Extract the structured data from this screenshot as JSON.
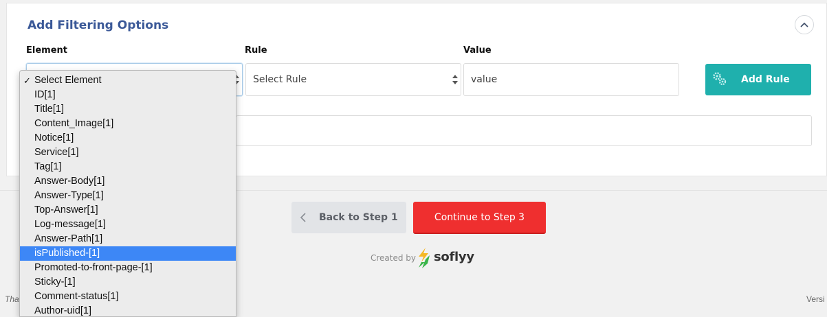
{
  "panel": {
    "title": "Add Filtering Options"
  },
  "fields": {
    "element_label": "Element",
    "rule_label": "Rule",
    "value_label": "Value",
    "rule_select_value": "Select Rule",
    "value_placeholder": "value",
    "add_rule_label": "Add Rule"
  },
  "dropdown": {
    "checked_item": "Select Element",
    "items": [
      "Select Element",
      "ID[1]",
      "Title[1]",
      "Content_Image[1]",
      "Notice[1]",
      "Service[1]",
      "Tag[1]",
      "Answer-Body[1]",
      "Answer-Type[1]",
      "Top-Answer[1]",
      "Log-message[1]",
      "Answer-Path[1]",
      "isPublished-[1]",
      "Promoted-to-front-page-[1]",
      "Sticky-[1]",
      "Comment-status[1]",
      "Author-uid[1]"
    ],
    "highlighted_item": "isPublished-[1]",
    "checkmark": "✓"
  },
  "navigation": {
    "back_label": "Back to Step 1",
    "continue_label": "Continue to Step 3"
  },
  "branding": {
    "created_by": "Created by",
    "logo_text": "soflyy"
  },
  "footer": {
    "left_text": "Tha",
    "right_text": "Versi"
  },
  "colors": {
    "title": "#3b5998",
    "add_rule": "#1fb0ad",
    "continue": "#ef2f2f",
    "highlight": "#3d87f6"
  }
}
